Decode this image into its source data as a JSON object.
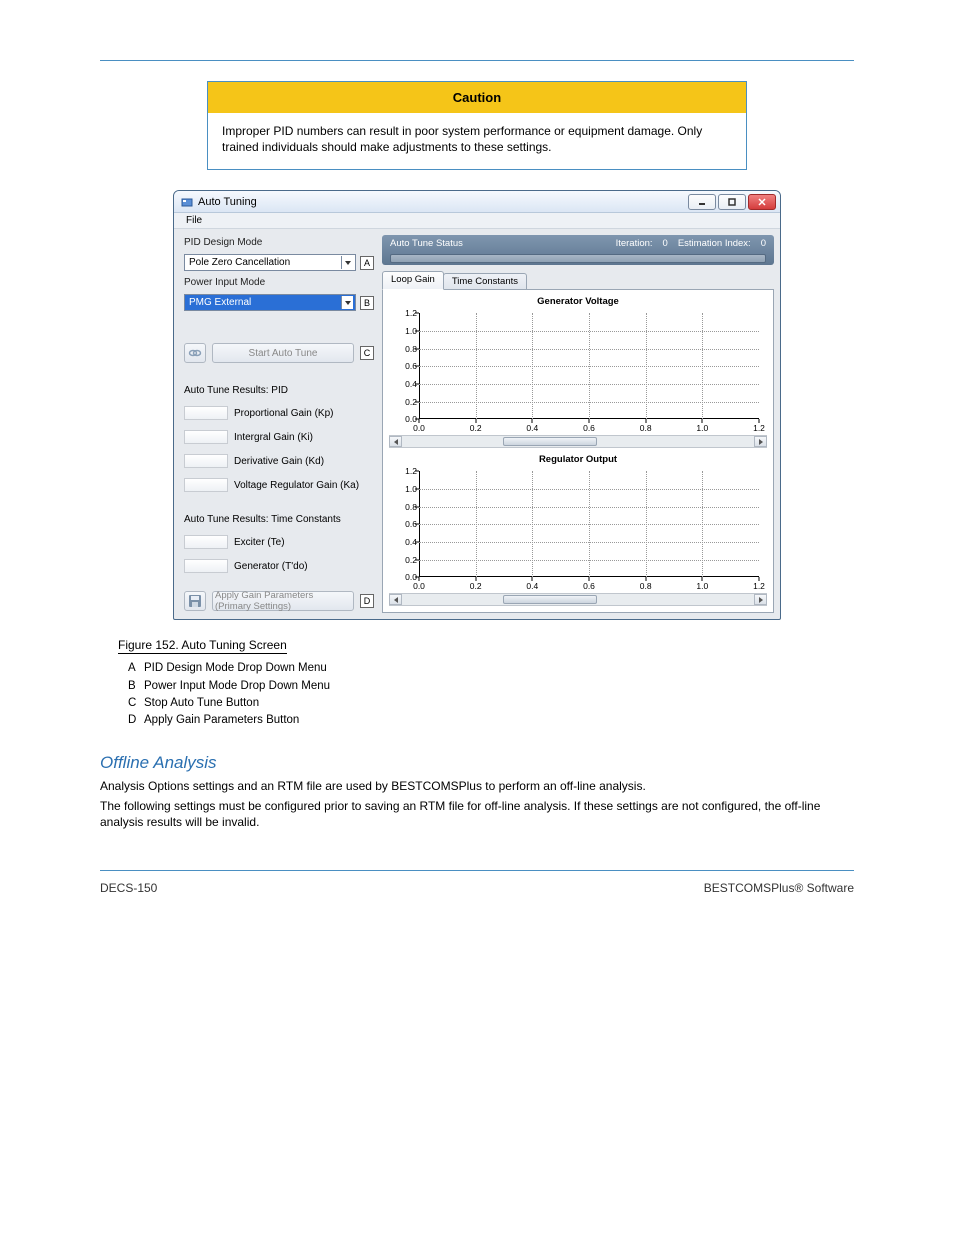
{
  "caution": {
    "heading": "Caution",
    "body": "Improper PID numbers can result in poor system performance or equipment damage. Only trained individuals should make adjustments to these settings."
  },
  "window": {
    "title": "Auto Tuning",
    "menu_file": "File",
    "left": {
      "pid_mode_label": "PID Design Mode",
      "pid_mode_value": "Pole Zero Cancellation",
      "letter_a": "A",
      "power_mode_label": "Power Input Mode",
      "power_mode_value": "PMG External",
      "letter_b": "B",
      "start_label": "Start Auto Tune",
      "letter_c": "C",
      "pid_section": "Auto Tune Results: PID",
      "pid_rows": [
        "Proportional Gain (Kp)",
        "Intergral Gain (Ki)",
        "Derivative Gain (Kd)",
        "Voltage Regulator Gain (Ka)"
      ],
      "tc_section": "Auto Tune Results: Time Constants",
      "tc_rows": [
        "Exciter (Te)",
        "Generator (T'do)"
      ],
      "apply_label": "Apply Gain Parameters (Primary Settings)",
      "letter_d": "D"
    },
    "status": {
      "title": "Auto Tune Status",
      "iteration_label": "Iteration:",
      "iteration_value": "0",
      "est_label": "Estimation Index:",
      "est_value": "0"
    },
    "tabs": {
      "active": "Loop Gain",
      "inactive": "Time Constants"
    },
    "chart_top": {
      "title": "Generator Voltage"
    },
    "chart_bottom": {
      "title": "Regulator Output"
    }
  },
  "figure_caption": "Figure 152. Auto Tuning Screen",
  "callouts": [
    {
      "k": "A",
      "v": "PID Design Mode Drop Down Menu"
    },
    {
      "k": "B",
      "v": "Power Input Mode Drop Down Menu"
    },
    {
      "k": "C",
      "v": "Stop Auto Tune Button"
    },
    {
      "k": "D",
      "v": "Apply Gain Parameters Button"
    }
  ],
  "content": {
    "h1": "Offline Analysis",
    "p1": "Analysis Options settings and an RTM file are used by BESTCOMSPlus to perform an off-line analysis.",
    "p2": "The following settings must be configured prior to saving an RTM file for off-line analysis. If these settings are not configured, the off-line analysis results will be invalid."
  },
  "chart_data": [
    {
      "type": "line",
      "title": "Generator Voltage",
      "x": [
        0.0,
        0.2,
        0.4,
        0.6,
        0.8,
        1.0,
        1.2
      ],
      "series": [],
      "xlim": [
        0.0,
        1.2
      ],
      "ylim": [
        0.0,
        1.2
      ],
      "yticks": [
        0.0,
        0.2,
        0.4,
        0.6,
        0.8,
        1.0,
        1.2
      ],
      "grid": true
    },
    {
      "type": "line",
      "title": "Regulator Output",
      "x": [
        0.0,
        0.2,
        0.4,
        0.6,
        0.8,
        1.0,
        1.2
      ],
      "series": [],
      "xlim": [
        0.0,
        1.2
      ],
      "ylim": [
        0.0,
        1.2
      ],
      "yticks": [
        0.0,
        0.2,
        0.4,
        0.6,
        0.8,
        1.0,
        1.2
      ],
      "grid": true
    }
  ],
  "footer": {
    "left": "DECS-150",
    "right": "BESTCOMSPlus® Software"
  }
}
